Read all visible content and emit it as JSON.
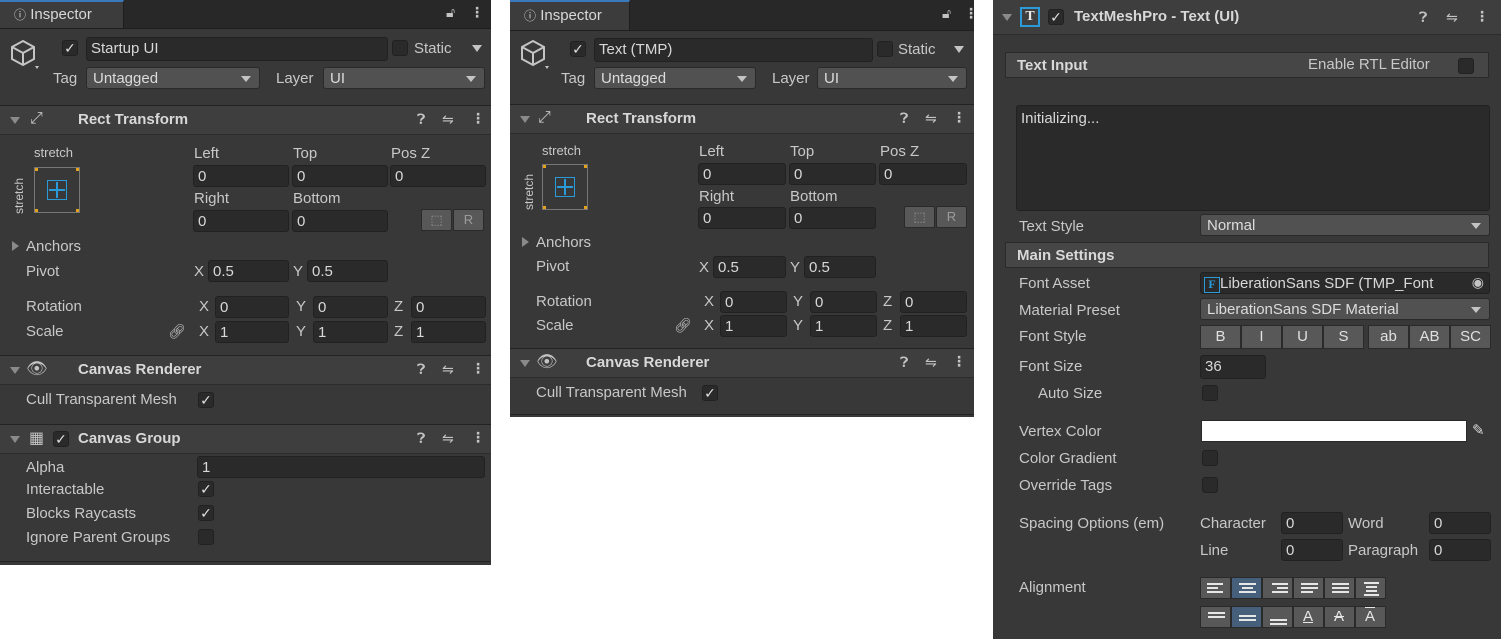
{
  "left_inspector": {
    "tab": "Inspector",
    "object": {
      "active": true,
      "name": "Startup UI",
      "static_label": "Static",
      "tag_label": "Tag",
      "tag_value": "Untagged",
      "layer_label": "Layer",
      "layer_value": "UI"
    },
    "rect_transform": {
      "title": "Rect Transform",
      "anchor_preset_h": "stretch",
      "anchor_preset_v": "stretch",
      "labels": {
        "left": "Left",
        "top": "Top",
        "posz": "Pos Z",
        "right": "Right",
        "bottom": "Bottom"
      },
      "values": {
        "left": "0",
        "top": "0",
        "posz": "0",
        "right": "0",
        "bottom": "0"
      },
      "anchors_label": "Anchors",
      "pivot_label": "Pivot",
      "pivot": {
        "x": "0.5",
        "y": "0.5"
      },
      "rotation_label": "Rotation",
      "rotation": {
        "x": "0",
        "y": "0",
        "z": "0"
      },
      "scale_label": "Scale",
      "scale": {
        "x": "1",
        "y": "1",
        "z": "1"
      },
      "axis": {
        "x": "X",
        "y": "Y",
        "z": "Z"
      },
      "btn_r": "R"
    },
    "canvas_renderer": {
      "title": "Canvas Renderer",
      "cull_label": "Cull Transparent Mesh",
      "cull_value": true
    },
    "canvas_group": {
      "title": "Canvas Group",
      "alpha_label": "Alpha",
      "alpha_value": "1",
      "interactable_label": "Interactable",
      "blocks_label": "Blocks Raycasts",
      "ignore_label": "Ignore Parent Groups"
    }
  },
  "mid_inspector": {
    "tab": "Inspector",
    "object": {
      "active": true,
      "name": "Text (TMP)",
      "static_label": "Static",
      "tag_label": "Tag",
      "tag_value": "Untagged",
      "layer_label": "Layer",
      "layer_value": "UI"
    },
    "rect_transform": {
      "title": "Rect Transform",
      "anchor_preset_h": "stretch",
      "anchor_preset_v": "stretch",
      "labels": {
        "left": "Left",
        "top": "Top",
        "posz": "Pos Z",
        "right": "Right",
        "bottom": "Bottom"
      },
      "values": {
        "left": "0",
        "top": "0",
        "posz": "0",
        "right": "0",
        "bottom": "0"
      },
      "anchors_label": "Anchors",
      "pivot_label": "Pivot",
      "pivot": {
        "x": "0.5",
        "y": "0.5"
      },
      "rotation_label": "Rotation",
      "rotation": {
        "x": "0",
        "y": "0",
        "z": "0"
      },
      "scale_label": "Scale",
      "scale": {
        "x": "1",
        "y": "1",
        "z": "1"
      },
      "axis": {
        "x": "X",
        "y": "Y",
        "z": "Z"
      },
      "btn_r": "R"
    },
    "canvas_renderer": {
      "title": "Canvas Renderer",
      "cull_label": "Cull Transparent Mesh",
      "cull_value": true
    }
  },
  "tmp": {
    "title": "TextMeshPro - Text (UI)",
    "icon_letter": "T",
    "text_input_label": "Text Input",
    "rtl_label": "Enable RTL Editor",
    "text_value": "Initializing...",
    "text_style_label": "Text Style",
    "text_style_value": "Normal",
    "main_settings_label": "Main Settings",
    "font_asset_label": "Font Asset",
    "font_asset_icon": "F",
    "font_asset_value": "LiberationSans SDF (TMP_Font",
    "material_preset_label": "Material Preset",
    "material_preset_value": "LiberationSans SDF Material",
    "font_style_label": "Font Style",
    "font_style_buttons": [
      "B",
      "I",
      "U",
      "S",
      "ab",
      "AB",
      "SC"
    ],
    "font_size_label": "Font Size",
    "font_size_value": "36",
    "auto_size_label": "Auto Size",
    "vertex_color_label": "Vertex Color",
    "vertex_color": "#ffffff",
    "color_gradient_label": "Color Gradient",
    "override_tags_label": "Override Tags",
    "spacing_label": "Spacing Options (em)",
    "character_label": "Character",
    "character_value": "0",
    "word_label": "Word",
    "word_value": "0",
    "line_label": "Line",
    "line_value": "0",
    "paragraph_label": "Paragraph",
    "paragraph_value": "0",
    "alignment_label": "Alignment"
  },
  "colors": {
    "panel": "#383838",
    "header": "#3e3e3e",
    "field": "#2a2a2a",
    "selected": "#46607c",
    "anchor_blue": "#2a9bd8",
    "anchor_orange": "#e3a11c"
  }
}
